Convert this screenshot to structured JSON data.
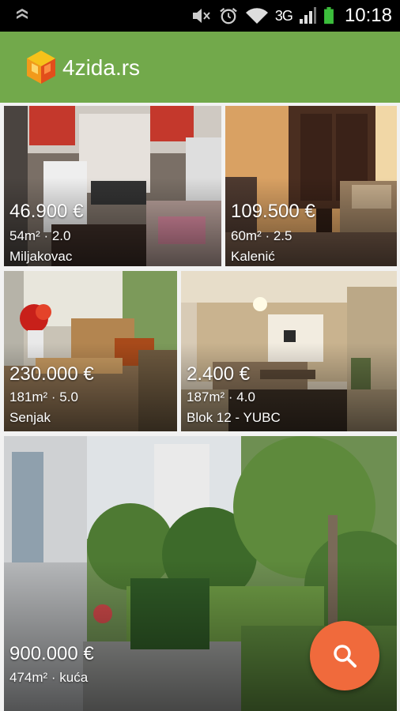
{
  "status_bar": {
    "network": "3G",
    "time": "10:18",
    "icons": [
      "notification-icon",
      "mute-icon",
      "alarm-icon",
      "wifi-icon",
      "signal-icon",
      "battery-icon"
    ]
  },
  "app_bar": {
    "title": "4zida.rs",
    "logo": "4zida-logo"
  },
  "listings": [
    {
      "price": "46.900 €",
      "meta": "54m² · 2.0",
      "location": "Miljakovac"
    },
    {
      "price": "109.500 €",
      "meta": "60m² · 2.5",
      "location": "Kalenić"
    },
    {
      "price": "230.000 €",
      "meta": "181m² · 5.0",
      "location": "Senjak"
    },
    {
      "price": "2.400 €",
      "meta": "187m² · 4.0",
      "location": "Blok 12 - YUBC"
    },
    {
      "price": "900.000 €",
      "meta": "474m² · kuća",
      "location": ""
    }
  ],
  "fab": {
    "icon": "search-icon"
  },
  "colors": {
    "appbar": "#72a94b",
    "fab": "#f06a3c",
    "statusbar": "#000000"
  }
}
